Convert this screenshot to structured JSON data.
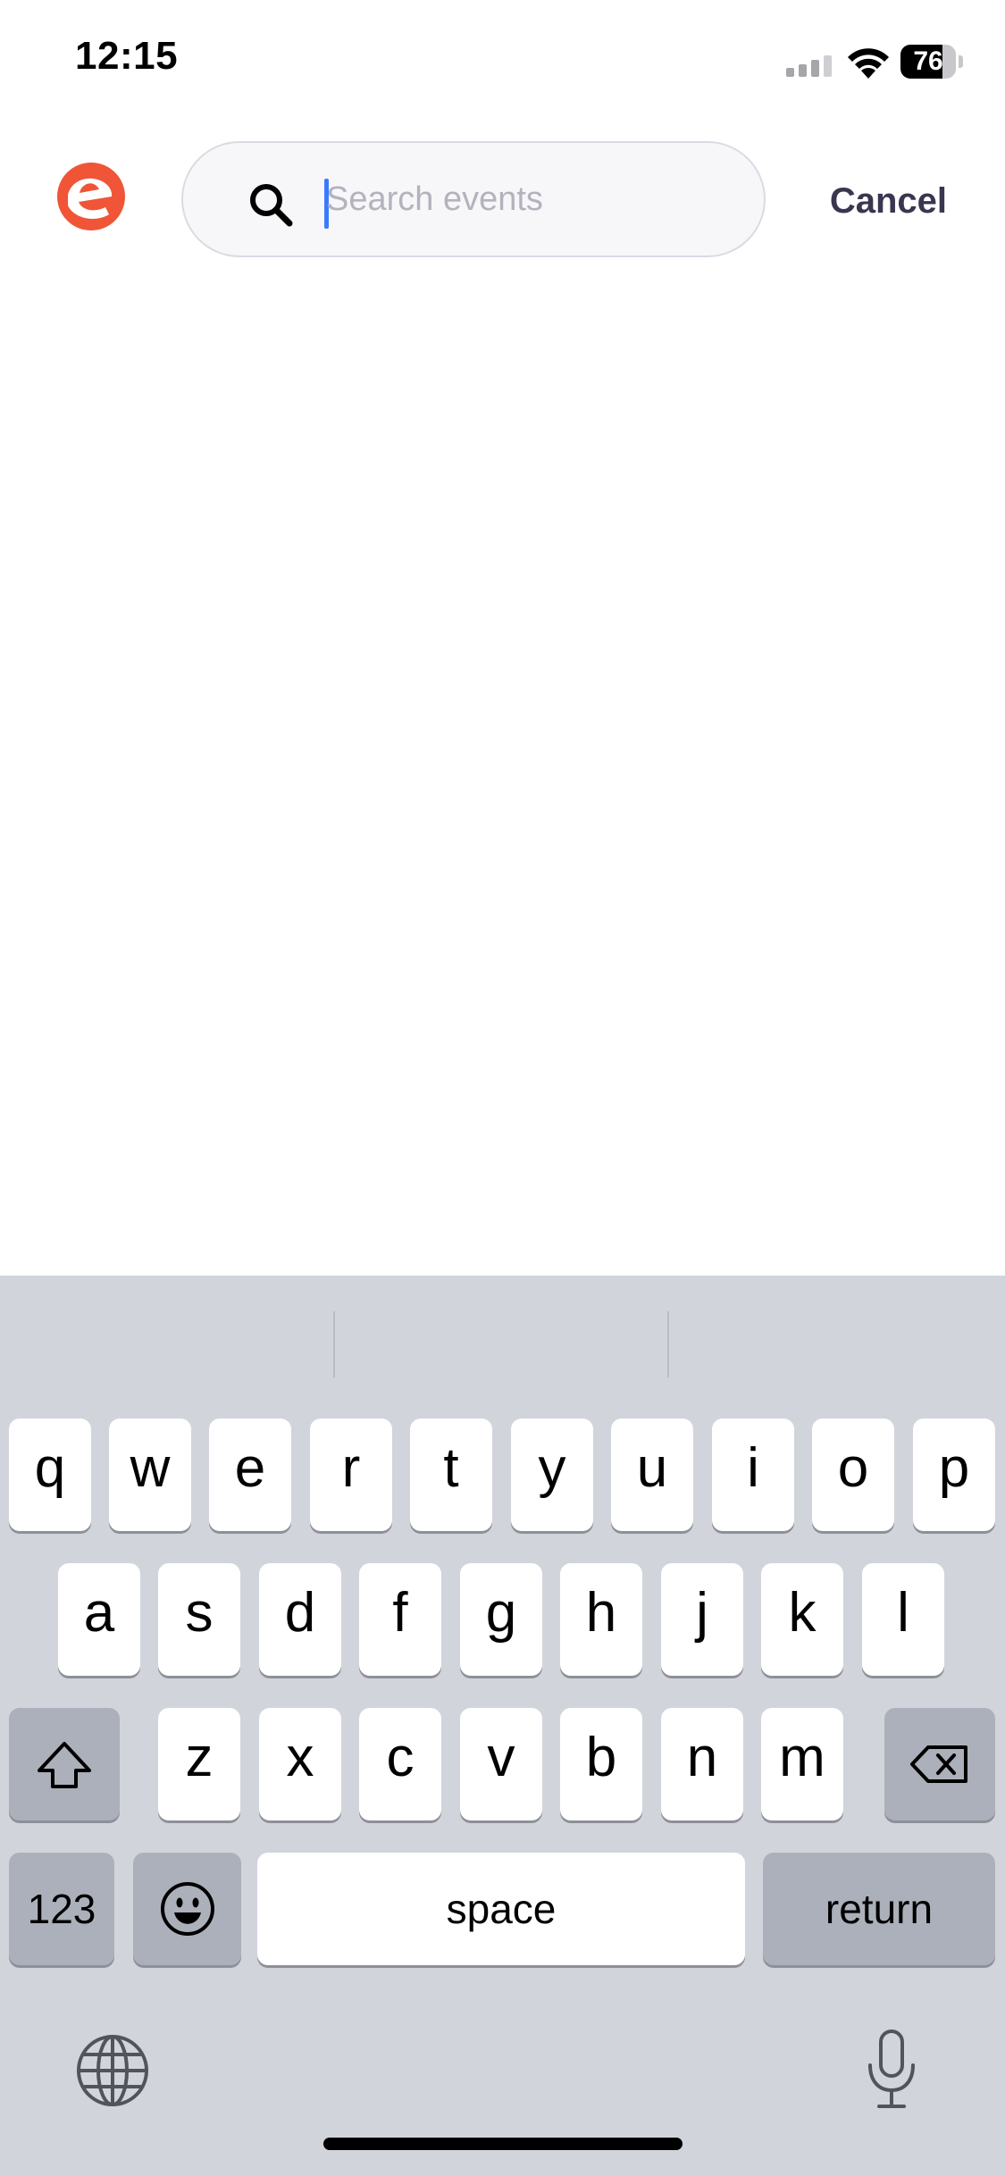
{
  "status_bar": {
    "time": "12:15",
    "battery_level": "76",
    "battery_fraction": 0.76,
    "icons": [
      "signal-icon",
      "wifi-icon",
      "battery-icon"
    ]
  },
  "header": {
    "logo_icon": "eventbrite-logo-icon",
    "logo_color": "#f05537",
    "search": {
      "placeholder": "Search events",
      "value": ""
    },
    "cancel_label": "Cancel"
  },
  "keyboard": {
    "row1": [
      "q",
      "w",
      "e",
      "r",
      "t",
      "y",
      "u",
      "i",
      "o",
      "p"
    ],
    "row2": [
      "a",
      "s",
      "d",
      "f",
      "g",
      "h",
      "j",
      "k",
      "l"
    ],
    "row3": [
      "z",
      "x",
      "c",
      "v",
      "b",
      "n",
      "m"
    ],
    "numbers_label": "123",
    "space_label": "space",
    "return_label": "return",
    "icons": [
      "shift-icon",
      "backspace-icon",
      "emoji-icon",
      "globe-icon",
      "microphone-icon"
    ]
  }
}
